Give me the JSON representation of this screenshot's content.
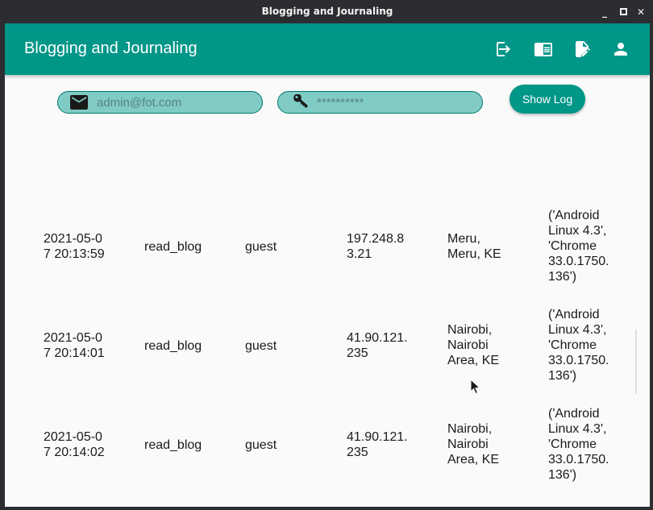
{
  "window": {
    "title": "Blogging and Journaling"
  },
  "appbar": {
    "title": "Blogging and Journaling",
    "icons": [
      "login-icon",
      "chrome-reader-icon",
      "edit-note-icon",
      "person-icon"
    ],
    "color": "#009688"
  },
  "form": {
    "email_placeholder": "admin@fot.com",
    "password_placeholder": "**********",
    "show_log_label": "Show Log"
  },
  "log_rows": [
    {
      "timestamp": "2021-05-0\n7 20:13:59",
      "action": "read_blog",
      "user": "guest",
      "ip": "197.248.8\n3.21",
      "location": "Meru,\nMeru, KE",
      "agent": "('Android\nLinux 4.3',\n'Chrome\n33.0.1750.\n136')"
    },
    {
      "timestamp": "2021-05-0\n7 20:14:01",
      "action": "read_blog",
      "user": "guest",
      "ip": "41.90.121.\n235",
      "location": "Nairobi,\nNairobi\nArea, KE",
      "agent": "('Android\nLinux 4.3',\n'Chrome\n33.0.1750.\n136')"
    },
    {
      "timestamp": "2021-05-0\n7 20:14:02",
      "action": "read_blog",
      "user": "guest",
      "ip": "41.90.121.\n235",
      "location": "Nairobi,\nNairobi\nArea, KE",
      "agent": "('Android\nLinux 4.3',\n'Chrome\n33.0.1750.\n136')"
    }
  ]
}
